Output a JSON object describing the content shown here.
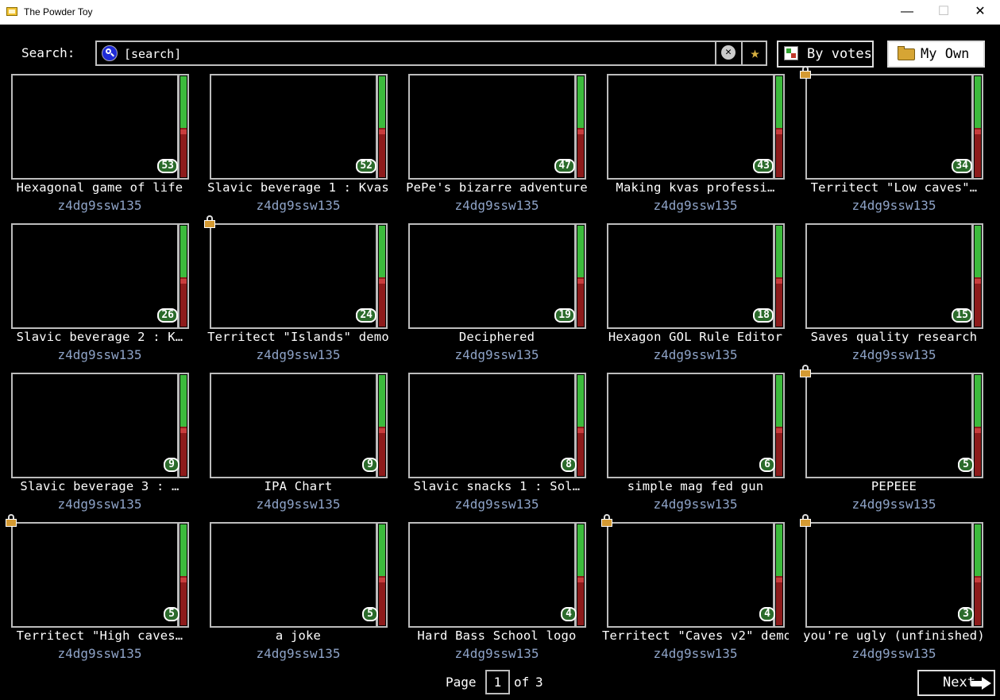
{
  "window": {
    "title": "The Powder Toy",
    "minimize": "—",
    "maximize": "☐",
    "close": "✕"
  },
  "search": {
    "label": "Search:",
    "placeholder": "[search]",
    "clear_glyph": "✕",
    "fav_glyph": "★"
  },
  "buttons": {
    "sort_label": "By votes",
    "own_label": "My Own"
  },
  "colors": {
    "vote_up": "#3dbb3d",
    "vote_down": "#8d1b1b",
    "author": "#8ea3c7"
  },
  "saves": [
    {
      "name": "Hexagonal game of life",
      "author": "z4dg9ssw135",
      "score": "53",
      "up_fraction": 0.52,
      "locked": false
    },
    {
      "name": "Slavic beverage 1 : Kvas",
      "author": "z4dg9ssw135",
      "score": "52",
      "up_fraction": 0.52,
      "locked": false
    },
    {
      "name": "PePe's bizarre adventure",
      "author": "z4dg9ssw135",
      "score": "47",
      "up_fraction": 0.52,
      "locked": false
    },
    {
      "name": "Making kvas professi…",
      "author": "z4dg9ssw135",
      "score": "43",
      "up_fraction": 0.52,
      "locked": false
    },
    {
      "name": "Territect \"Low caves\"…",
      "author": "z4dg9ssw135",
      "score": "34",
      "up_fraction": 0.52,
      "locked": true
    },
    {
      "name": "Slavic beverage 2 : K…",
      "author": "z4dg9ssw135",
      "score": "26",
      "up_fraction": 0.52,
      "locked": false
    },
    {
      "name": "Territect \"Islands\" demo",
      "author": "z4dg9ssw135",
      "score": "24",
      "up_fraction": 0.52,
      "locked": true
    },
    {
      "name": "Deciphered",
      "author": "z4dg9ssw135",
      "score": "19",
      "up_fraction": 0.52,
      "locked": false
    },
    {
      "name": "Hexagon GOL Rule Editor",
      "author": "z4dg9ssw135",
      "score": "18",
      "up_fraction": 0.52,
      "locked": false
    },
    {
      "name": "Saves quality research",
      "author": "z4dg9ssw135",
      "score": "15",
      "up_fraction": 0.52,
      "locked": false
    },
    {
      "name": "Slavic beverage 3 : …",
      "author": "z4dg9ssw135",
      "score": "9",
      "up_fraction": 0.52,
      "locked": false
    },
    {
      "name": "IPA Chart",
      "author": "z4dg9ssw135",
      "score": "9",
      "up_fraction": 0.52,
      "locked": false
    },
    {
      "name": "Slavic snacks 1 : Sol…",
      "author": "z4dg9ssw135",
      "score": "8",
      "up_fraction": 0.52,
      "locked": false
    },
    {
      "name": "simple mag fed gun",
      "author": "z4dg9ssw135",
      "score": "6",
      "up_fraction": 0.52,
      "locked": false
    },
    {
      "name": "PEPEEE",
      "author": "z4dg9ssw135",
      "score": "5",
      "up_fraction": 0.52,
      "locked": true
    },
    {
      "name": "Territect \"High caves…",
      "author": "z4dg9ssw135",
      "score": "5",
      "up_fraction": 0.52,
      "locked": true
    },
    {
      "name": "a joke",
      "author": "z4dg9ssw135",
      "score": "5",
      "up_fraction": 0.52,
      "locked": false
    },
    {
      "name": "Hard Bass School logo",
      "author": "z4dg9ssw135",
      "score": "4",
      "up_fraction": 0.52,
      "locked": false
    },
    {
      "name": "Territect \"Caves v2\" demo",
      "author": "z4dg9ssw135",
      "score": "4",
      "up_fraction": 0.52,
      "locked": true
    },
    {
      "name": "you're ugly (unfinished)",
      "author": "z4dg9ssw135",
      "score": "3",
      "up_fraction": 0.52,
      "locked": true
    }
  ],
  "pagination": {
    "page_label": "Page",
    "current": "1",
    "of_label": "of",
    "total": "3",
    "next_label": "Next"
  }
}
